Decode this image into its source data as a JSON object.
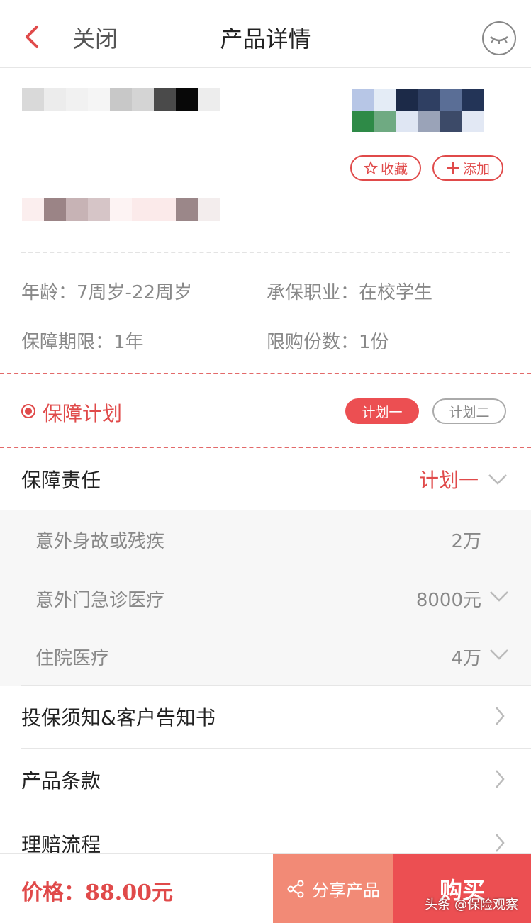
{
  "nav": {
    "close_label": "关闭",
    "title": "产品详情"
  },
  "product": {
    "favorite_label": "收藏",
    "add_label": "添加"
  },
  "info": {
    "age_label": "年龄：",
    "age_value": "7周岁-22周岁",
    "occupation_label": "承保职业：",
    "occupation_value": "在校学生",
    "term_label": "保障期限：",
    "term_value": "1年",
    "limit_label": "限购份数：",
    "limit_value": "1份"
  },
  "plan": {
    "title": "保障计划",
    "options": [
      "计划一",
      "计划二"
    ],
    "selected": "计划一"
  },
  "coverage": {
    "title": "保障责任",
    "selected_plan": "计划一",
    "items": [
      {
        "label": "意外身故或残疾",
        "value": "2万"
      },
      {
        "label": "意外门急诊医疗",
        "value": "8000元"
      },
      {
        "label": "住院医疗",
        "value": "4万"
      }
    ]
  },
  "links": [
    {
      "label": "投保须知&客户告知书"
    },
    {
      "label": "产品条款"
    },
    {
      "label": "理赔流程"
    }
  ],
  "bottom": {
    "price_label": "价格：88.00元",
    "share_label": "分享产品",
    "buy_label": "购买"
  },
  "watermark": "头条 @保险观察",
  "colors": {
    "accent": "#e04a4a",
    "buy": "#ec4f52",
    "share": "#f28a76"
  }
}
